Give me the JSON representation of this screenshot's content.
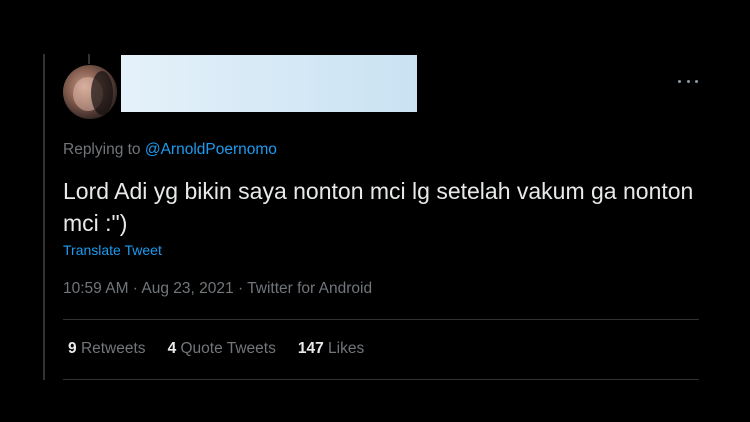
{
  "tweet": {
    "replying_prefix": "Replying to ",
    "replying_handle": "@ArnoldPoernomo",
    "text": "Lord Adi yg bikin saya nonton mci lg setelah vakum ga nonton mci :\")",
    "translate_label": "Translate Tweet",
    "time": "10:59 AM",
    "date": "Aug 23, 2021",
    "source": "Twitter for Android",
    "separator": " · "
  },
  "stats": {
    "retweets": {
      "count": "9",
      "label": "Retweets"
    },
    "quotes": {
      "count": "4",
      "label": "Quote Tweets"
    },
    "likes": {
      "count": "147",
      "label": "Likes"
    }
  },
  "icons": {
    "more": "more-horizontal-icon"
  },
  "colors": {
    "background": "#000000",
    "text_primary": "#e7e9ea",
    "text_secondary": "#71767b",
    "accent": "#1d9bf0",
    "divider": "#2f3336",
    "redaction": "#cfe5f4"
  }
}
